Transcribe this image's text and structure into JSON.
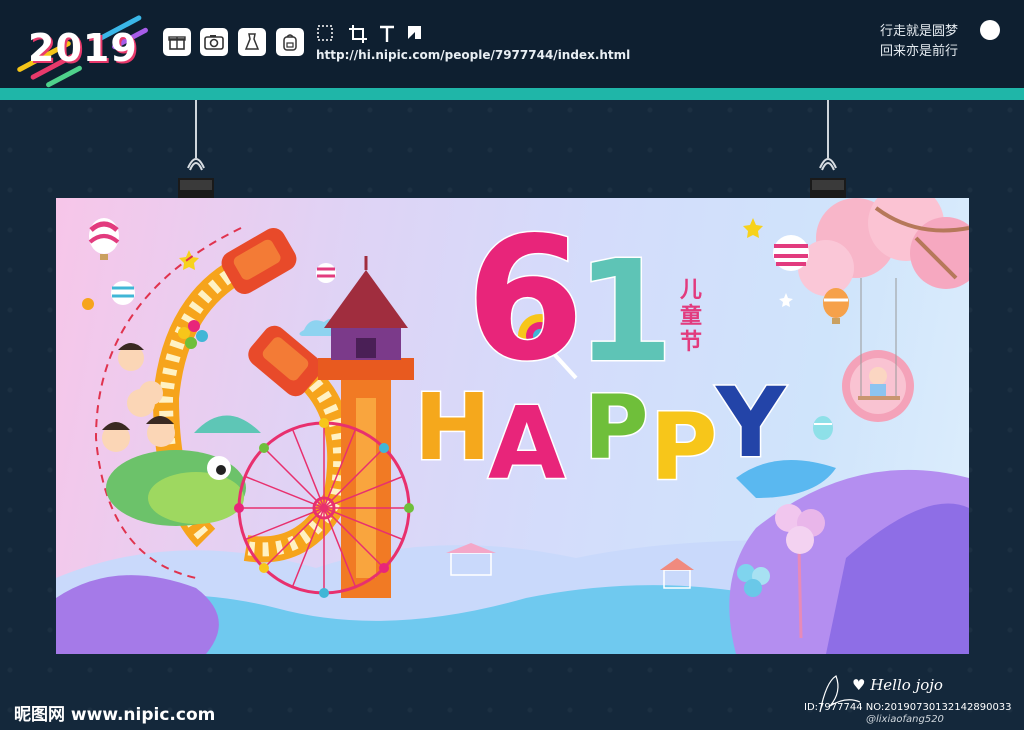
{
  "header": {
    "logo_year": "2019",
    "url": "http://hi.nipic.com/people/7977744/index.html",
    "motto_line1": "行走就是圆梦",
    "motto_line2": "回来亦是前行",
    "tools": [
      "gift-icon",
      "camera-icon",
      "dress-icon",
      "backpack-icon",
      "select-icon",
      "crop-icon",
      "text-icon",
      "corner-icon"
    ]
  },
  "banner": {
    "number": "61",
    "number_first_digit": "6",
    "number_second_digit": "1",
    "festival": "儿童节",
    "happy_letters": [
      "H",
      "A",
      "P",
      "P",
      "Y"
    ],
    "happy_colors": [
      "#f5a81c",
      "#e8257a",
      "#6fbf3a",
      "#f7c61a",
      "#2344a8"
    ]
  },
  "footer": {
    "site": "昵图网 www.nipic.com",
    "hello": "♥ Hello jojo",
    "id_line": "ID:7977744 NO:20190730132142890033",
    "signature": "@lixiaofang520"
  }
}
